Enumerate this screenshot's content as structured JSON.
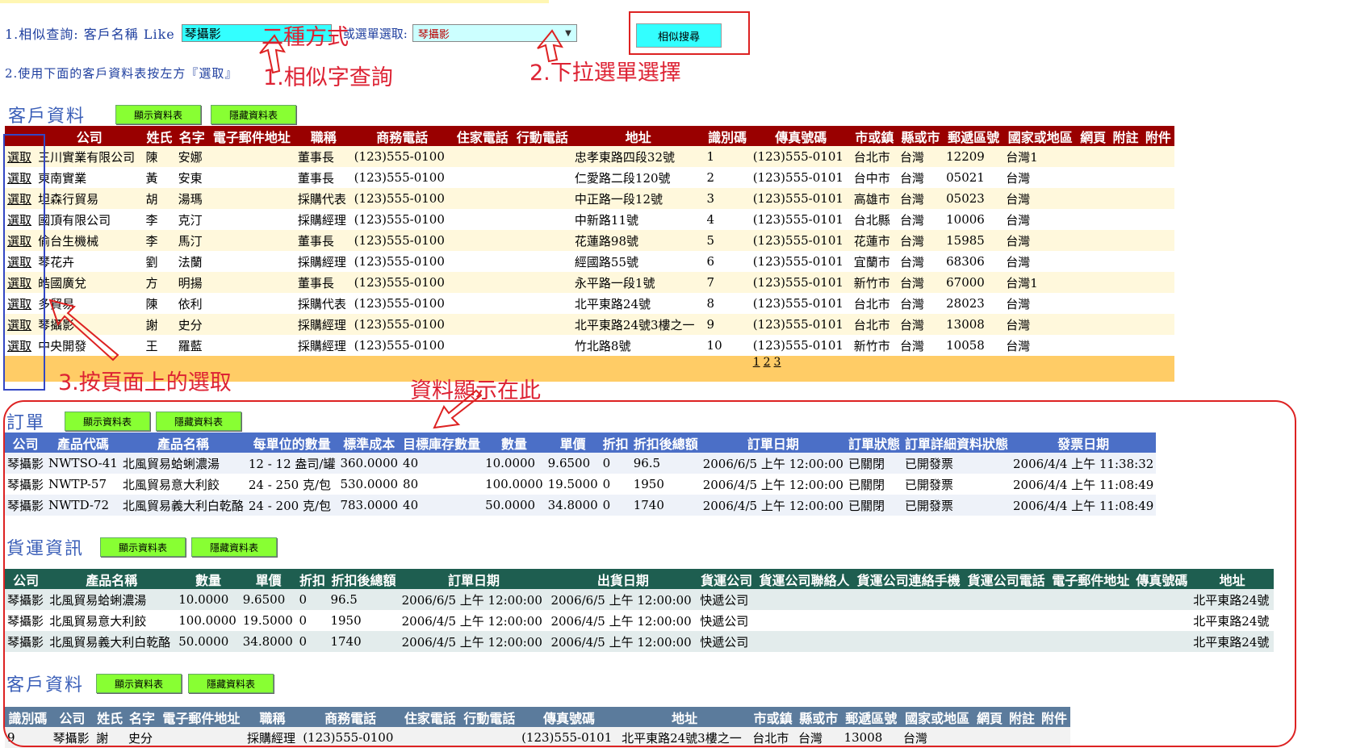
{
  "query": {
    "line1_label": "1.相似查詢: 客戶名稱 Like",
    "search_value": "琴攝影",
    "or_label": "或選單選取:",
    "select_value": "琴攝影",
    "search_button": "相似搜尋",
    "line2_label": "2.使用下面的客戶資料表按左方『選取』"
  },
  "annotations": {
    "two_ways": "二種方式",
    "similar_text": "1.相似字查詢",
    "dropdown_text": "2.下拉選單選擇",
    "press_select": "3.按頁面上的選取",
    "data_shown": "資料顯示在此"
  },
  "customer": {
    "title": "客戶資料",
    "show_btn": "顯示資料表",
    "hide_btn": "隱藏資料表",
    "columns": [
      "",
      "公司",
      "姓氏",
      "名字",
      "電子郵件地址",
      "職稱",
      "商務電話",
      "住家電話",
      "行動電話",
      "地址",
      "識別碼",
      "傳真號碼",
      "市或鎮",
      "縣或市",
      "郵遞區號",
      "國家或地區",
      "網頁",
      "附註",
      "附件"
    ],
    "select_label": "選取",
    "rows": [
      [
        "三川實業有限公司",
        "陳",
        "安娜",
        "",
        "董事長",
        "(123)555-0100",
        "",
        "",
        "忠孝東路四段32號",
        "1",
        "(123)555-0101",
        "台北市",
        "台灣",
        "12209",
        "台灣1",
        "",
        "",
        ""
      ],
      [
        "東南實業",
        "黃",
        "安東",
        "",
        "董事長",
        "(123)555-0100",
        "",
        "",
        "仁愛路二段120號",
        "2",
        "(123)555-0101",
        "台中市",
        "台灣",
        "05021",
        "台灣",
        "",
        "",
        ""
      ],
      [
        "坦森行貿易",
        "胡",
        "湯瑪",
        "",
        "採購代表",
        "(123)555-0100",
        "",
        "",
        "中正路一段12號",
        "3",
        "(123)555-0101",
        "高雄市",
        "台灣",
        "05023",
        "台灣",
        "",
        "",
        ""
      ],
      [
        "國頂有限公司",
        "李",
        "克汀",
        "",
        "採購經理",
        "(123)555-0100",
        "",
        "",
        "中新路11號",
        "4",
        "(123)555-0101",
        "台北縣",
        "台灣",
        "10006",
        "台灣",
        "",
        "",
        ""
      ],
      [
        "偷台生機械",
        "李",
        "馬汀",
        "",
        "董事長",
        "(123)555-0100",
        "",
        "",
        "花蓮路98號",
        "5",
        "(123)555-0101",
        "花蓮市",
        "台灣",
        "15985",
        "台灣",
        "",
        "",
        ""
      ],
      [
        "琴花卉",
        "劉",
        "法蘭",
        "",
        "採購經理",
        "(123)555-0100",
        "",
        "",
        "經國路55號",
        "6",
        "(123)555-0101",
        "宜蘭市",
        "台灣",
        "68306",
        "台灣",
        "",
        "",
        ""
      ],
      [
        "皓國廣兌",
        "方",
        "明揚",
        "",
        "董事長",
        "(123)555-0100",
        "",
        "",
        "永平路一段1號",
        "7",
        "(123)555-0101",
        "新竹市",
        "台灣",
        "67000",
        "台灣1",
        "",
        "",
        ""
      ],
      [
        "多貿易",
        "陳",
        "依利",
        "",
        "採購代表",
        "(123)555-0100",
        "",
        "",
        "北平東路24號",
        "8",
        "(123)555-0101",
        "台北市",
        "台灣",
        "28023",
        "台灣",
        "",
        "",
        ""
      ],
      [
        "琴攝影",
        "謝",
        "史分",
        "",
        "採購經理",
        "(123)555-0100",
        "",
        "",
        "北平東路24號3樓之一",
        "9",
        "(123)555-0101",
        "台北市",
        "台灣",
        "13008",
        "台灣",
        "",
        "",
        ""
      ],
      [
        "中央開發",
        "王",
        "羅藍",
        "",
        "採購經理",
        "(123)555-0100",
        "",
        "",
        "竹北路8號",
        "10",
        "(123)555-0101",
        "新竹市",
        "台灣",
        "10058",
        "台灣",
        "",
        "",
        ""
      ]
    ],
    "pages": [
      "1",
      "2",
      "3"
    ]
  },
  "orders": {
    "title": "訂單",
    "show_btn": "顯示資料表",
    "hide_btn": "隱藏資料表",
    "columns": [
      "公司",
      "產品代碼",
      "產品名稱",
      "每單位的數量",
      "標準成本",
      "目標庫存數量",
      "數量",
      "單價",
      "折扣",
      "折扣後總額",
      "訂單日期",
      "訂單狀態",
      "訂單詳細資料狀態",
      "發票日期"
    ],
    "rows": [
      [
        "琴攝影",
        "NWTSO-41",
        "北風貿易蛤蜊濃湯",
        "12 - 12 盎司/罐",
        "360.0000",
        "40",
        "10.0000",
        "9.6500",
        "0",
        "96.5",
        "2006/6/5 上午 12:00:00",
        "已關閉",
        "已開發票",
        "2006/4/4 上午 11:38:32"
      ],
      [
        "琴攝影",
        "NWTP-57",
        "北風貿易意大利餃",
        "24 - 250 克/包",
        "530.0000",
        "80",
        "100.0000",
        "19.5000",
        "0",
        "1950",
        "2006/4/5 上午 12:00:00",
        "已關閉",
        "已開發票",
        "2006/4/4 上午 11:08:49"
      ],
      [
        "琴攝影",
        "NWTD-72",
        "北風貿易義大利白乾酪",
        "24 - 200 克/包",
        "783.0000",
        "40",
        "50.0000",
        "34.8000",
        "0",
        "1740",
        "2006/4/5 上午 12:00:00",
        "已關閉",
        "已開發票",
        "2006/4/4 上午 11:08:49"
      ]
    ]
  },
  "shipping": {
    "title": "貨運資訊",
    "show_btn": "顯示資料表",
    "hide_btn": "隱藏資料表",
    "columns": [
      "公司",
      "產品名稱",
      "數量",
      "單價",
      "折扣",
      "折扣後總額",
      "訂單日期",
      "出貨日期",
      "貨運公司",
      "貨運公司聯絡人",
      "貨運公司連絡手機",
      "貨運公司電話",
      "電子郵件地址",
      "傳真號碼",
      "地址"
    ],
    "rows": [
      [
        "琴攝影",
        "北風貿易蛤蜊濃湯",
        "10.0000",
        "9.6500",
        "0",
        "96.5",
        "2006/6/5 上午 12:00:00",
        "2006/6/5 上午 12:00:00",
        "快遞公司",
        "",
        "",
        "",
        "",
        "",
        "北平東路24號"
      ],
      [
        "琴攝影",
        "北風貿易意大利餃",
        "100.0000",
        "19.5000",
        "0",
        "1950",
        "2006/4/5 上午 12:00:00",
        "2006/4/5 上午 12:00:00",
        "快遞公司",
        "",
        "",
        "",
        "",
        "",
        "北平東路24號"
      ],
      [
        "琴攝影",
        "北風貿易義大利白乾酪",
        "50.0000",
        "34.8000",
        "0",
        "1740",
        "2006/4/5 上午 12:00:00",
        "2006/4/5 上午 12:00:00",
        "快遞公司",
        "",
        "",
        "",
        "",
        "",
        "北平東路24號"
      ]
    ]
  },
  "customer_detail": {
    "title": "客戶資料",
    "show_btn": "顯示資料表",
    "hide_btn": "隱藏資料表",
    "columns": [
      "識別碼",
      "公司",
      "姓氏",
      "名字",
      "電子郵件地址",
      "職稱",
      "商務電話",
      "住家電話",
      "行動電話",
      "傳真號碼",
      "地址",
      "市或鎮",
      "縣或市",
      "郵遞區號",
      "國家或地區",
      "網頁",
      "附註",
      "附件"
    ],
    "rows": [
      [
        "9",
        "琴攝影",
        "謝",
        "史分",
        "",
        "採購經理",
        "(123)555-0100",
        "",
        "",
        "(123)555-0101",
        "北平東路24號3樓之一",
        "台北市",
        "台灣",
        "13008",
        "台灣",
        "",
        "",
        ""
      ]
    ]
  },
  "colors": {
    "customer_header": "#990000",
    "orders_header": "#4b6fc7",
    "shipping_header": "#1e5e50",
    "detail_header": "#5b7b9c",
    "annotation": "#d22222"
  }
}
